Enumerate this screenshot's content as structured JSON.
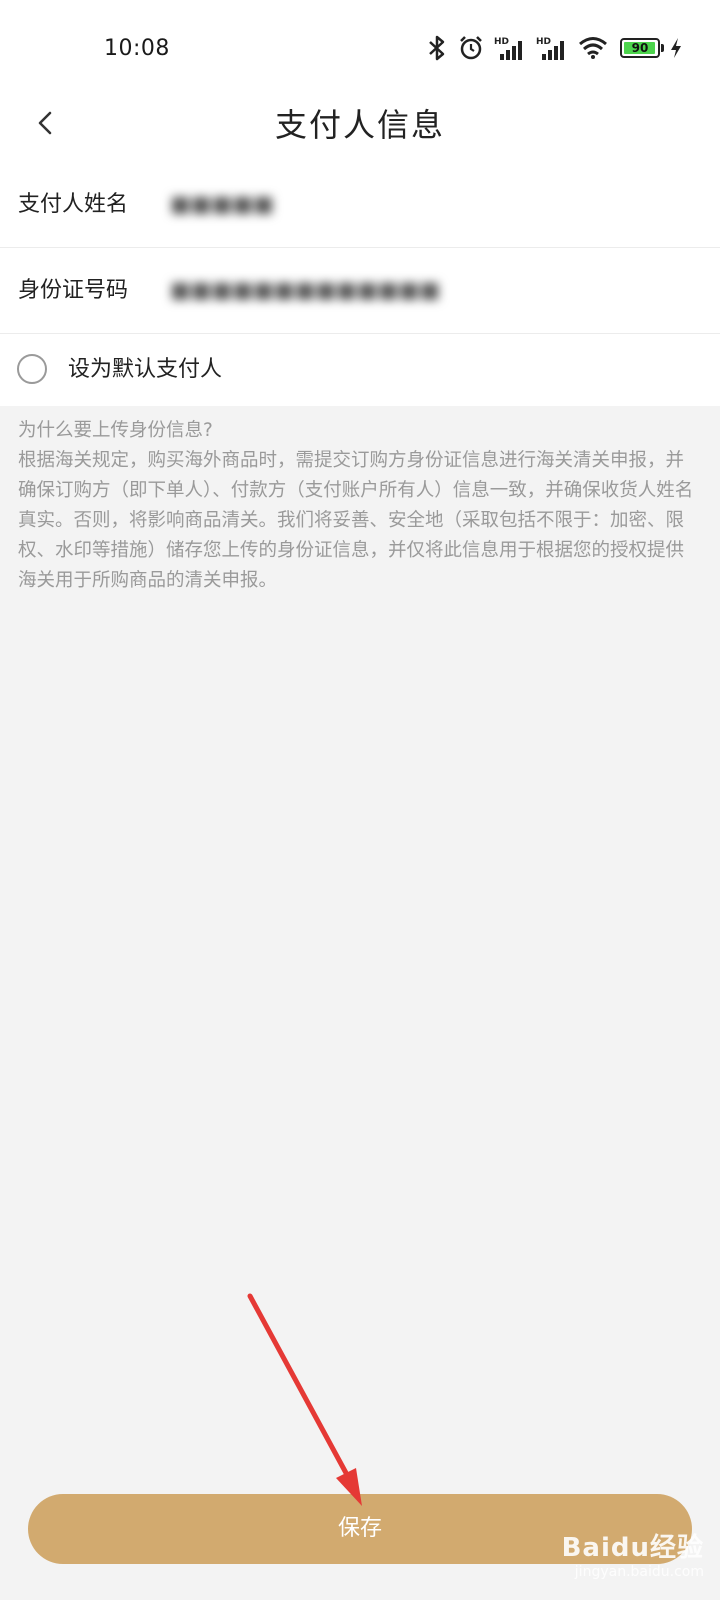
{
  "status_bar": {
    "time": "10:08",
    "icons": [
      "bluetooth-icon",
      "alarm-icon",
      "signal-hd-icon",
      "signal-hd-icon",
      "wifi-icon",
      "battery-icon",
      "charging-icon"
    ],
    "battery_level": "90",
    "hd_label": "HD"
  },
  "header": {
    "title": "支付人信息",
    "back_icon": "chevron-left-icon"
  },
  "form": {
    "name_label": "支付人姓名",
    "name_value": "■■■■■",
    "id_label": "身份证号码",
    "id_value": "■■■■■■■■■■■■■",
    "default_label": "设为默认支付人",
    "default_checked": false
  },
  "info": {
    "question": "为什么要上传身份信息?",
    "body": "根据海关规定，购买海外商品时，需提交订购方身份证信息进行海关清关申报，并确保订购方（即下单人）、付款方（支付账户所有人）信息一致，并确保收货人姓名真实。否则，将影响商品清关。我们将妥善、安全地（采取包括不限于：加密、限权、水印等措施）储存您上传的身份证信息，并仅将此信息用于根据您的授权提供海关用于所购商品的清关申报。"
  },
  "footer": {
    "save_label": "保存"
  },
  "watermark": {
    "brand": "Baidu经验",
    "url": "jingyan.baidu.com"
  },
  "colors": {
    "accent": "#d2aa6f",
    "background": "#f3f3f3",
    "annotation_arrow": "#e53935"
  }
}
